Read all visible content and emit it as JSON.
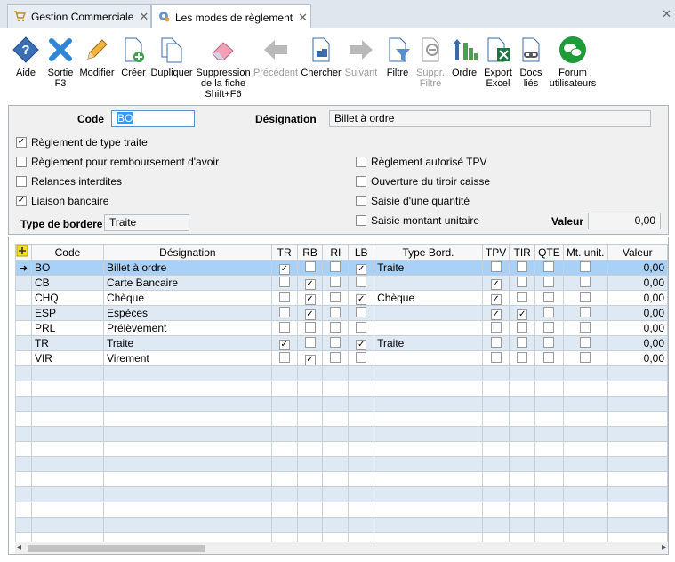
{
  "tabs": [
    {
      "label": "Gestion Commerciale",
      "close": "✕"
    },
    {
      "label": "Les modes de règlement",
      "close": "✕"
    }
  ],
  "window_close": "✕",
  "toolbar": [
    {
      "id": "aide",
      "label": "Aide",
      "icon": "help-diamond-icon",
      "disabled": false
    },
    {
      "id": "sortie",
      "label": "Sortie\nF3",
      "icon": "exit-x-icon",
      "disabled": false
    },
    {
      "id": "modifier",
      "label": "Modifier",
      "icon": "pencil-icon",
      "disabled": false
    },
    {
      "id": "creer",
      "label": "Créer",
      "icon": "new-document-icon",
      "disabled": false
    },
    {
      "id": "dupliquer",
      "label": "Dupliquer",
      "icon": "duplicate-icon",
      "disabled": false
    },
    {
      "id": "suppression",
      "label": "Suppression\nde la fiche\nShift+F6",
      "icon": "eraser-icon",
      "disabled": false
    },
    {
      "id": "precedent",
      "label": "Précédent",
      "icon": "arrow-left-icon",
      "disabled": true
    },
    {
      "id": "chercher",
      "label": "Chercher",
      "icon": "search-document-icon",
      "disabled": false
    },
    {
      "id": "suivant",
      "label": "Suivant",
      "icon": "arrow-right-icon",
      "disabled": true
    },
    {
      "id": "filtre",
      "label": "Filtre",
      "icon": "filter-icon",
      "disabled": false
    },
    {
      "id": "suppr_filtre",
      "label": "Suppr.\nFiltre",
      "icon": "remove-filter-icon",
      "disabled": true
    },
    {
      "id": "ordre",
      "label": "Ordre",
      "icon": "sort-icon",
      "disabled": false
    },
    {
      "id": "export_excel",
      "label": "Export\nExcel",
      "icon": "excel-icon",
      "disabled": false
    },
    {
      "id": "docs_lies",
      "label": "Docs\nliés",
      "icon": "linked-docs-icon",
      "disabled": false
    },
    {
      "id": "forum",
      "label": "Forum\nutilisateurs",
      "icon": "forum-icon",
      "disabled": false
    }
  ],
  "form": {
    "code_label": "Code",
    "code_value": "BO",
    "designation_label": "Désignation",
    "designation_value": "Billet à ordre",
    "reg_traite": {
      "label": "Règlement de type traite",
      "checked": true
    },
    "reg_rembours": {
      "label": "Règlement pour remboursement d'avoir",
      "checked": false
    },
    "relances": {
      "label": "Relances interdites",
      "checked": false
    },
    "liaison": {
      "label": "Liaison bancaire",
      "checked": true
    },
    "type_bordereau_label": "Type de bordere",
    "type_bordereau_value": "Traite",
    "reg_tpv": {
      "label": "Règlement autorisé TPV",
      "checked": false
    },
    "ouverture": {
      "label": "Ouverture du tiroir caisse",
      "checked": false
    },
    "saisie_qte": {
      "label": "Saisie d'une quantité",
      "checked": false
    },
    "saisie_montant": {
      "label": "Saisie montant unitaire",
      "checked": false
    },
    "valeur_label": "Valeur",
    "valeur_value": "0,00"
  },
  "grid": {
    "headers": [
      "",
      "Code",
      "Désignation",
      "TR",
      "RB",
      "RI",
      "LB",
      "Type Bord.",
      "TPV",
      "TIR",
      "QTE",
      "Mt. unit.",
      "Valeur"
    ],
    "rows": [
      {
        "code": "BO",
        "designation": "Billet à ordre",
        "tr": true,
        "rb": false,
        "ri": false,
        "lb": true,
        "type": "Traite",
        "tpv": false,
        "tir": false,
        "qte": false,
        "mt": false,
        "valeur": "0,00",
        "current": true
      },
      {
        "code": "CB",
        "designation": "Carte Bancaire",
        "tr": false,
        "rb": true,
        "ri": false,
        "lb": false,
        "type": "",
        "tpv": true,
        "tir": false,
        "qte": false,
        "mt": false,
        "valeur": "0,00"
      },
      {
        "code": "CHQ",
        "designation": "Chèque",
        "tr": false,
        "rb": true,
        "ri": false,
        "lb": true,
        "type": "Chèque",
        "tpv": true,
        "tir": false,
        "qte": false,
        "mt": false,
        "valeur": "0,00"
      },
      {
        "code": "ESP",
        "designation": "Espèces",
        "tr": false,
        "rb": true,
        "ri": false,
        "lb": false,
        "type": "",
        "tpv": true,
        "tir": true,
        "qte": false,
        "mt": false,
        "valeur": "0,00"
      },
      {
        "code": "PRL",
        "designation": "Prélèvement",
        "tr": false,
        "rb": false,
        "ri": false,
        "lb": false,
        "type": "",
        "tpv": false,
        "tir": false,
        "qte": false,
        "mt": false,
        "valeur": "0,00"
      },
      {
        "code": "TR",
        "designation": "Traite",
        "tr": true,
        "rb": false,
        "ri": false,
        "lb": true,
        "type": "Traite",
        "tpv": false,
        "tir": false,
        "qte": false,
        "mt": false,
        "valeur": "0,00"
      },
      {
        "code": "VIR",
        "designation": "Virement",
        "tr": false,
        "rb": true,
        "ri": false,
        "lb": false,
        "type": "",
        "tpv": false,
        "tir": false,
        "qte": false,
        "mt": false,
        "valeur": "0,00"
      }
    ],
    "empty_rows": 12,
    "current_row_marker": "➜",
    "add_icon": "add-row-icon"
  },
  "colors": {
    "selected_row": "#a9d1f5",
    "zebra_row": "#dfe9f4",
    "panel_bg": "#f0f0f0",
    "tab_bg": "#dfe6ee"
  }
}
